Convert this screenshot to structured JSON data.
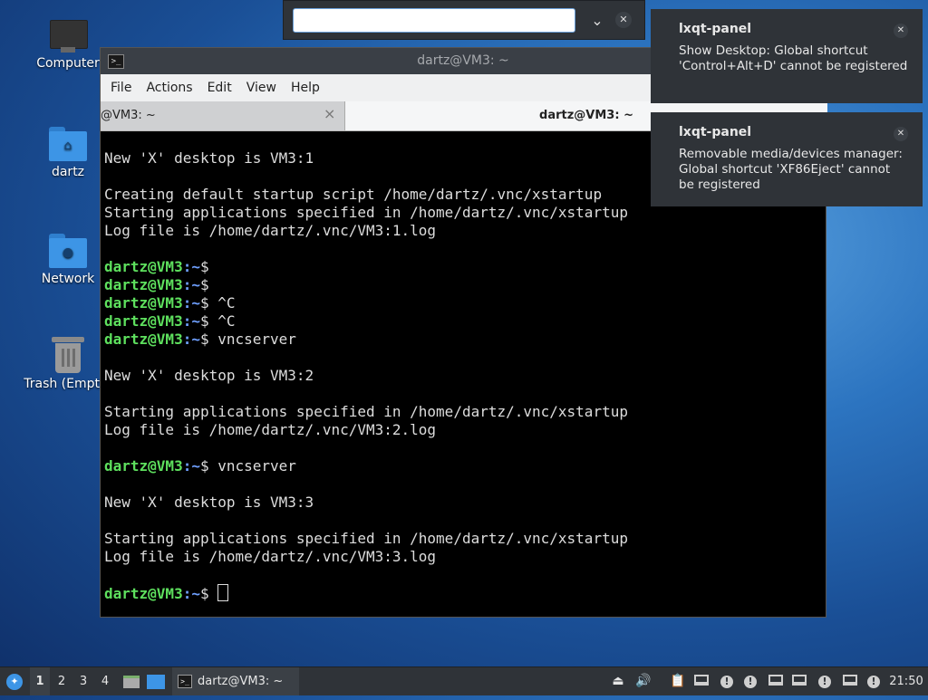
{
  "desktop": {
    "icons": [
      {
        "label": "Computer"
      },
      {
        "label": "dartz"
      },
      {
        "label": "Network"
      },
      {
        "label": "Trash (Empty)"
      }
    ]
  },
  "run_dialog": {
    "value": "",
    "dropdown_icon": "chevron-down-icon",
    "close_icon": "close-icon"
  },
  "window": {
    "title": "dartz@VM3: ~",
    "menu": [
      "File",
      "Actions",
      "Edit",
      "View",
      "Help"
    ],
    "tabs": [
      {
        "label": "@VM3: ~",
        "active": false
      },
      {
        "label": "dartz@VM3: ~",
        "active": true
      }
    ]
  },
  "terminal": {
    "prompt_user": "dartz@VM3",
    "prompt_path": ":~",
    "lines": [
      {
        "type": "out",
        "text": "New 'X' desktop is VM3:1"
      },
      {
        "type": "out",
        "text": ""
      },
      {
        "type": "out",
        "text": "Creating default startup script /home/dartz/.vnc/xstartup"
      },
      {
        "type": "out",
        "text": "Starting applications specified in /home/dartz/.vnc/xstartup"
      },
      {
        "type": "out",
        "text": "Log file is /home/dartz/.vnc/VM3:1.log"
      },
      {
        "type": "out",
        "text": ""
      },
      {
        "type": "prompt",
        "cmd": ""
      },
      {
        "type": "prompt",
        "cmd": ""
      },
      {
        "type": "prompt",
        "cmd": "^C"
      },
      {
        "type": "prompt",
        "cmd": "^C"
      },
      {
        "type": "prompt",
        "cmd": "vncserver"
      },
      {
        "type": "out",
        "text": ""
      },
      {
        "type": "out",
        "text": "New 'X' desktop is VM3:2"
      },
      {
        "type": "out",
        "text": ""
      },
      {
        "type": "out",
        "text": "Starting applications specified in /home/dartz/.vnc/xstartup"
      },
      {
        "type": "out",
        "text": "Log file is /home/dartz/.vnc/VM3:2.log"
      },
      {
        "type": "out",
        "text": ""
      },
      {
        "type": "prompt",
        "cmd": "vncserver"
      },
      {
        "type": "out",
        "text": ""
      },
      {
        "type": "out",
        "text": "New 'X' desktop is VM3:3"
      },
      {
        "type": "out",
        "text": ""
      },
      {
        "type": "out",
        "text": "Starting applications specified in /home/dartz/.vnc/xstartup"
      },
      {
        "type": "out",
        "text": "Log file is /home/dartz/.vnc/VM3:3.log"
      },
      {
        "type": "out",
        "text": ""
      },
      {
        "type": "prompt",
        "cmd": "",
        "cursor": true
      }
    ]
  },
  "notifications": [
    {
      "app": "lxqt-panel",
      "body": "Show Desktop: Global shortcut 'Control+Alt+D' cannot be registered"
    },
    {
      "app": "lxqt-panel",
      "body": "Removable media/devices manager: Global shortcut 'XF86Eject' cannot be registered"
    }
  ],
  "taskbar": {
    "workspaces": [
      "1",
      "2",
      "3",
      "4"
    ],
    "active_workspace": "1",
    "task_label": "dartz@VM3: ~",
    "clock": "21:50"
  }
}
